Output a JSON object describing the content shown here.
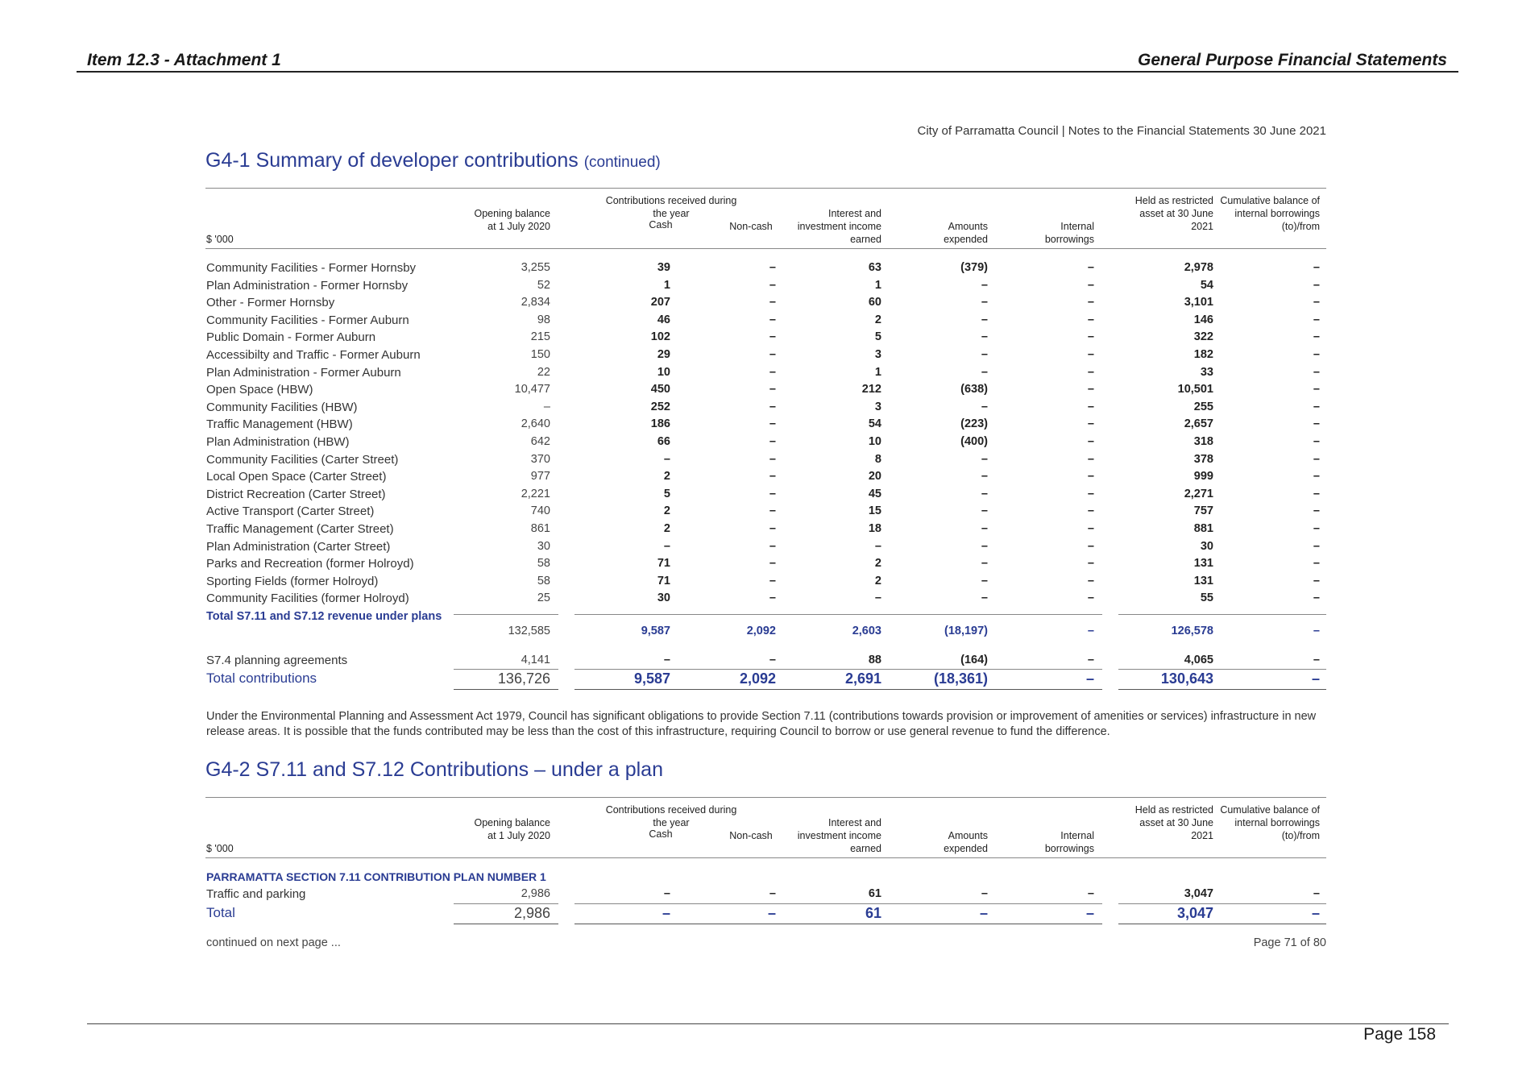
{
  "header": {
    "left": "Item 12.3 - Attachment 1",
    "right": "General Purpose Financial Statements"
  },
  "source_note": "City of Parramatta Council | Notes to the Financial Statements 30 June 2021",
  "section1": {
    "title": "G4-1   Summary of developer contributions",
    "title_suffix": "(continued)",
    "unit": "$ '000",
    "columns": {
      "opening": "Opening balance at 1 July 2020",
      "contrib_group": "Contributions received during the year",
      "cash": "Cash",
      "noncash": "Non-cash",
      "interest": "Interest and investment income earned",
      "expended": "Amounts expended",
      "borrowings": "Internal borrowings",
      "held": "Held as restricted asset at 30 June 2021",
      "cumulative": "Cumulative balance of internal borrowings (to)/from"
    },
    "rows": [
      {
        "label": "Community Facilities  - Former Hornsby",
        "opening": "3,255",
        "cash": "39",
        "noncash": "–",
        "interest": "63",
        "expended": "(379)",
        "borrowings": "–",
        "held": "2,978",
        "cumulative": "–"
      },
      {
        "label": "Plan Administration  - Former Hornsby",
        "opening": "52",
        "cash": "1",
        "noncash": "–",
        "interest": "1",
        "expended": "–",
        "borrowings": "–",
        "held": "54",
        "cumulative": "–"
      },
      {
        "label": "Other - Former Hornsby",
        "opening": "2,834",
        "cash": "207",
        "noncash": "–",
        "interest": "60",
        "expended": "–",
        "borrowings": "–",
        "held": "3,101",
        "cumulative": "–"
      },
      {
        "label": "Community Facilities  - Former Auburn",
        "opening": "98",
        "cash": "46",
        "noncash": "–",
        "interest": "2",
        "expended": "–",
        "borrowings": "–",
        "held": "146",
        "cumulative": "–"
      },
      {
        "label": "Public Domain - Former Auburn",
        "opening": "215",
        "cash": "102",
        "noncash": "–",
        "interest": "5",
        "expended": "–",
        "borrowings": "–",
        "held": "322",
        "cumulative": "–"
      },
      {
        "label": "Accessibilty and Traffic - Former Auburn",
        "opening": "150",
        "cash": "29",
        "noncash": "–",
        "interest": "3",
        "expended": "–",
        "borrowings": "–",
        "held": "182",
        "cumulative": "–"
      },
      {
        "label": "Plan Administration - Former Auburn",
        "opening": "22",
        "cash": "10",
        "noncash": "–",
        "interest": "1",
        "expended": "–",
        "borrowings": "–",
        "held": "33",
        "cumulative": "–"
      },
      {
        "label": "Open Space (HBW)",
        "opening": "10,477",
        "cash": "450",
        "noncash": "–",
        "interest": "212",
        "expended": "(638)",
        "borrowings": "–",
        "held": "10,501",
        "cumulative": "–"
      },
      {
        "label": "Community Facilities (HBW)",
        "opening": "–",
        "cash": "252",
        "noncash": "–",
        "interest": "3",
        "expended": "–",
        "borrowings": "–",
        "held": "255",
        "cumulative": "–"
      },
      {
        "label": "Traffic Management (HBW)",
        "opening": "2,640",
        "cash": "186",
        "noncash": "–",
        "interest": "54",
        "expended": "(223)",
        "borrowings": "–",
        "held": "2,657",
        "cumulative": "–"
      },
      {
        "label": "Plan Administration (HBW)",
        "opening": "642",
        "cash": "66",
        "noncash": "–",
        "interest": "10",
        "expended": "(400)",
        "borrowings": "–",
        "held": "318",
        "cumulative": "–"
      },
      {
        "label": "Community Facilities (Carter Street)",
        "opening": "370",
        "cash": "–",
        "noncash": "–",
        "interest": "8",
        "expended": "–",
        "borrowings": "–",
        "held": "378",
        "cumulative": "–"
      },
      {
        "label": "Local Open Space (Carter Street)",
        "opening": "977",
        "cash": "2",
        "noncash": "–",
        "interest": "20",
        "expended": "–",
        "borrowings": "–",
        "held": "999",
        "cumulative": "–"
      },
      {
        "label": "District Recreation (Carter Street)",
        "opening": "2,221",
        "cash": "5",
        "noncash": "–",
        "interest": "45",
        "expended": "–",
        "borrowings": "–",
        "held": "2,271",
        "cumulative": "–"
      },
      {
        "label": "Active Transport (Carter Street)",
        "opening": "740",
        "cash": "2",
        "noncash": "–",
        "interest": "15",
        "expended": "–",
        "borrowings": "–",
        "held": "757",
        "cumulative": "–"
      },
      {
        "label": "Traffic Management (Carter Street)",
        "opening": "861",
        "cash": "2",
        "noncash": "–",
        "interest": "18",
        "expended": "–",
        "borrowings": "–",
        "held": "881",
        "cumulative": "–"
      },
      {
        "label": "Plan Administration (Carter Street)",
        "opening": "30",
        "cash": "–",
        "noncash": "–",
        "interest": "–",
        "expended": "–",
        "borrowings": "–",
        "held": "30",
        "cumulative": "–"
      },
      {
        "label": "Parks and Recreation (former Holroyd)",
        "opening": "58",
        "cash": "71",
        "noncash": "–",
        "interest": "2",
        "expended": "–",
        "borrowings": "–",
        "held": "131",
        "cumulative": "–"
      },
      {
        "label": "Sporting Fields (former Holroyd)",
        "opening": "58",
        "cash": "71",
        "noncash": "–",
        "interest": "2",
        "expended": "–",
        "borrowings": "–",
        "held": "131",
        "cumulative": "–"
      },
      {
        "label": "Community Facilities (former Holroyd)",
        "opening": "25",
        "cash": "30",
        "noncash": "–",
        "interest": "–",
        "expended": "–",
        "borrowings": "–",
        "held": "55",
        "cumulative": "–"
      }
    ],
    "total_row": {
      "label": "Total S7.11 and S7.12 revenue under plans",
      "opening": "132,585",
      "cash": "9,587",
      "noncash": "2,092",
      "interest": "2,603",
      "expended": "(18,197)",
      "borrowings": "–",
      "held": "126,578",
      "cumulative": "–"
    },
    "planning_row": {
      "label": "S7.4 planning agreements",
      "opening": "4,141",
      "cash": "–",
      "noncash": "–",
      "interest": "88",
      "expended": "(164)",
      "borrowings": "–",
      "held": "4,065",
      "cumulative": "–"
    },
    "grand_row": {
      "label": "Total contributions",
      "opening": "136,726",
      "cash": "9,587",
      "noncash": "2,092",
      "interest": "2,691",
      "expended": "(18,361)",
      "borrowings": "–",
      "held": "130,643",
      "cumulative": "–"
    }
  },
  "paragraph": "Under the Environmental Planning and Assessment Act 1979, Council has significant obligations to provide Section 7.11 (contributions towards provision or improvement of amenities or services) infrastructure in new release areas. It is possible that the funds contributed may be less than the cost of this infrastructure, requiring Council to borrow or use general revenue to fund the difference.",
  "section2": {
    "title": "G4-2   S7.11 and S7.12 Contributions – under a plan",
    "unit": "$ '000",
    "plan_heading": "PARRAMATTA  SECTION 7.11 CONTRIBUTION PLAN NUMBER 1",
    "row": {
      "label": "Traffic and parking",
      "opening": "2,986",
      "cash": "–",
      "noncash": "–",
      "interest": "61",
      "expended": "–",
      "borrowings": "–",
      "held": "3,047",
      "cumulative": "–"
    },
    "total": {
      "label": "Total",
      "opening": "2,986",
      "cash": "–",
      "noncash": "–",
      "interest": "61",
      "expended": "–",
      "borrowings": "–",
      "held": "3,047",
      "cumulative": "–"
    }
  },
  "footer": {
    "continued": "continued on next page ...",
    "page_of": "Page 71 of 80",
    "page": "Page 158"
  }
}
